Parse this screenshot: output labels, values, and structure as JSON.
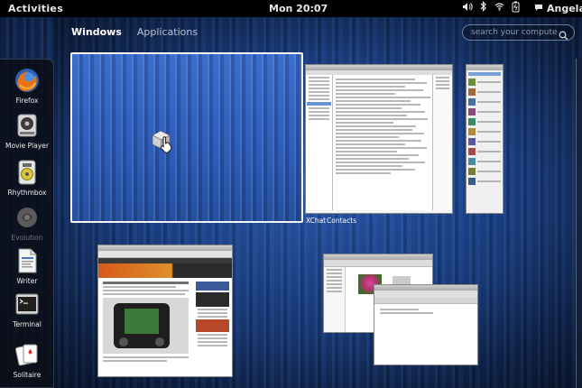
{
  "topbar": {
    "activities": "Activities",
    "clock": "Mon 20:07",
    "user": "Angela"
  },
  "overview": {
    "tab_windows": "Windows",
    "tab_applications": "Applications",
    "search_placeholder": "search your computer"
  },
  "dash": [
    {
      "label": "Firefox",
      "icon": "firefox-icon"
    },
    {
      "label": "Movie Player",
      "icon": "movie-player-icon"
    },
    {
      "label": "Rhythmbox",
      "icon": "rhythmbox-icon"
    },
    {
      "label": "Evolution",
      "icon": "evolution-icon"
    },
    {
      "label": "Writer",
      "icon": "writer-icon"
    },
    {
      "label": "Terminal",
      "icon": "terminal-icon"
    },
    {
      "label": "Solitaire",
      "icon": "solitaire-icon"
    }
  ],
  "windows": {
    "xchat_caption": "XChat",
    "contacts_caption": "Contacts"
  }
}
